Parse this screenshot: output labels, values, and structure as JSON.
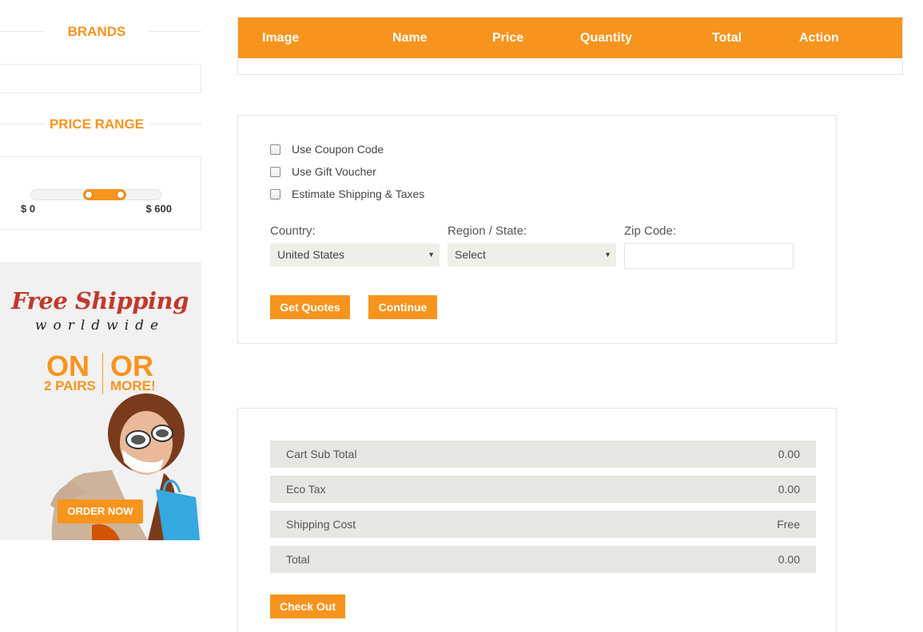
{
  "sidebar": {
    "brands_title": "BRANDS",
    "price_title": "PRICE RANGE",
    "price_min": "$ 0",
    "price_max": "$ 600",
    "slider": {
      "min": 0,
      "max": 600,
      "low": 240,
      "high": 440
    },
    "banner": {
      "line1": "Free Shipping",
      "line2": "worldwide",
      "on": "ON",
      "or": "OR",
      "pairs": "2 PAIRS",
      "more": "MORE!",
      "order_label": "ORDER NOW"
    }
  },
  "cart": {
    "headers": [
      "Image",
      "Name",
      "Price",
      "Quantity",
      "Total",
      "Action"
    ]
  },
  "shipping": {
    "options": [
      "Use Coupon Code",
      "Use Gift Voucher",
      "Estimate Shipping & Taxes"
    ],
    "country_label": "Country:",
    "country_value": "United States",
    "region_label": "Region / State:",
    "region_value": "Select",
    "zip_label": "Zip Code:",
    "zip_value": "",
    "get_quotes": "Get Quotes",
    "continue": "Continue"
  },
  "totals": {
    "rows": [
      {
        "label": "Cart Sub Total",
        "value": "0.00"
      },
      {
        "label": "Eco Tax",
        "value": "0.00"
      },
      {
        "label": "Shipping Cost",
        "value": "Free"
      },
      {
        "label": "Total",
        "value": "0.00"
      }
    ],
    "checkout": "Check Out"
  },
  "colors": {
    "accent": "#f7941d",
    "row_bg": "#e7e6e1",
    "banner_red": "#c0392b"
  }
}
